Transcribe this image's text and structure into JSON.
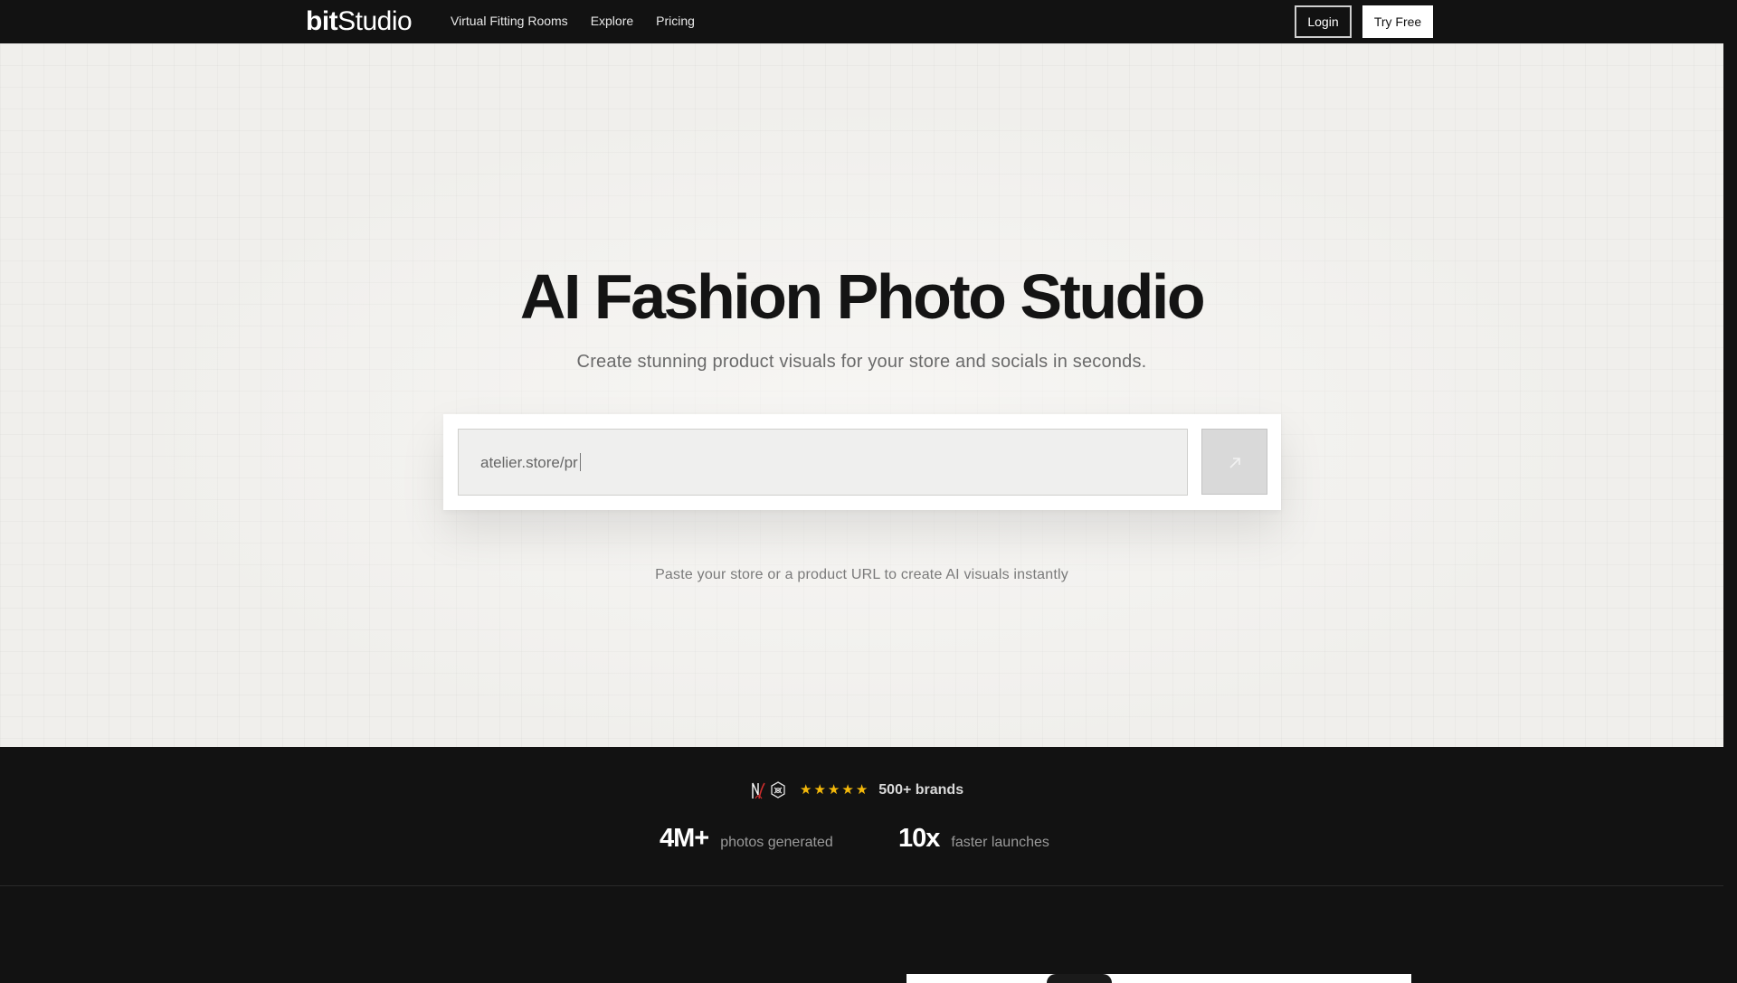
{
  "nav": {
    "logo_bold": "bit",
    "logo_light": "Studio",
    "links": [
      "Virtual Fitting Rooms",
      "Explore",
      "Pricing"
    ],
    "login_label": "Login",
    "try_free_label": "Try Free"
  },
  "hero": {
    "title": "AI Fashion Photo Studio",
    "subtitle": "Create stunning product visuals for your store and socials in seconds.",
    "input_value": "atelier.store/pr",
    "submit_icon": "arrow-up-right-icon",
    "hint": "Paste your store or a product URL to create AI visuals instantly"
  },
  "stats": {
    "rating_stars": 5,
    "star_color": "#f5b90a",
    "brands_text": "500+ brands",
    "items": [
      {
        "value": "4M+",
        "label": "photos generated"
      },
      {
        "value": "10x",
        "label": "faster launches"
      }
    ]
  },
  "colors": {
    "nav_bg": "#121212",
    "hero_bg": "#f0efec",
    "accent_white": "#ffffff"
  }
}
